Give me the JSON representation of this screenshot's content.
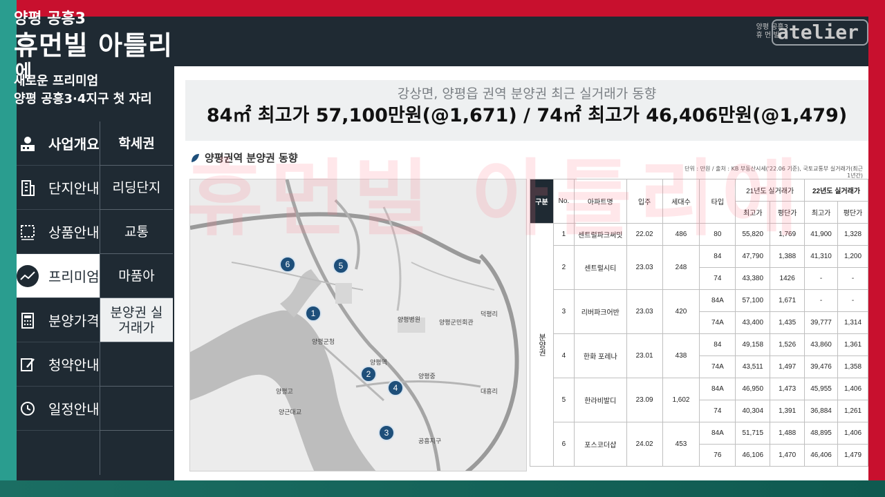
{
  "header": {
    "title_line1": "양평 공흥3",
    "title_line2": "휴먼빌 아틀리",
    "title_overflow": "에",
    "brand_line1": "양평 공흥3",
    "brand_line2": "휴 먼 빌",
    "brand_logo": "atelier"
  },
  "sidebar": {
    "subtitle1": "새로운 프리미엄",
    "subtitle2": "양평 공흥3·4지구 첫 자리",
    "menu": [
      {
        "label": "사업개요",
        "icon": "person-building-icon"
      },
      {
        "label": "단지안내",
        "icon": "building-icon"
      },
      {
        "label": "상품안내",
        "icon": "floorplan-icon"
      },
      {
        "label": "프리미엄",
        "icon": "trend-chart-icon"
      },
      {
        "label": "분양가격",
        "icon": "calculator-icon"
      },
      {
        "label": "청약안내",
        "icon": "document-pen-icon"
      },
      {
        "label": "일정안내",
        "icon": "clock-icon"
      }
    ],
    "submenu": [
      "학세권",
      "리딩단지",
      "교통",
      "마품아",
      "분양권 실거래가"
    ]
  },
  "main": {
    "banner_sub": "강상면, 양평읍 권역 분양권 최근 실거래가 동향",
    "banner_main": "84㎡ 최고가 57,100만원(@1,671) / 74㎡ 최고가 46,406만원(@1,479)",
    "section_title": "양평권역 분양권 동향",
    "unit_note": "단위 : 만원 / 출처 : KB 부동산시세('22.06 기준), 국토교통부 실거래가(최근 1년간)"
  },
  "map": {
    "pins": [
      "1",
      "2",
      "3",
      "4",
      "5",
      "6"
    ],
    "labels": [
      "양평군청",
      "양평역",
      "양평고",
      "양평중",
      "덕평리",
      "양평병원",
      "양평군민회관",
      "공흥지구",
      "대흥리",
      "양근대교"
    ]
  },
  "table": {
    "headers": {
      "category": "구분",
      "no": "No.",
      "name": "아파트명",
      "move_in": "입주",
      "households": "세대수",
      "type": "타입",
      "y21": "21년도 실거래가",
      "y22": "22년도 실거래가",
      "max": "최고가",
      "per_pyeong": "평단가"
    },
    "category_label": "분양권",
    "rows": [
      {
        "no": "1",
        "name": "센트럴파크써밋",
        "move_in": "22.02",
        "households": "486",
        "types": [
          {
            "type": "80",
            "a": "55,820",
            "b": "1,769",
            "c": "41,900",
            "d": "1,328"
          }
        ]
      },
      {
        "no": "2",
        "name": "센트럴시티",
        "move_in": "23.03",
        "households": "248",
        "types": [
          {
            "type": "84",
            "a": "47,790",
            "b": "1,388",
            "c": "41,310",
            "d": "1,200"
          },
          {
            "type": "74",
            "a": "43,380",
            "b": "1426",
            "c": "-",
            "d": "-"
          }
        ]
      },
      {
        "no": "3",
        "name": "리버파크어반",
        "move_in": "23.03",
        "households": "420",
        "types": [
          {
            "type": "84A",
            "a": "57,100",
            "b": "1,671",
            "c": "-",
            "d": "-"
          },
          {
            "type": "74A",
            "a": "43,400",
            "b": "1,435",
            "c": "39,777",
            "d": "1,314"
          }
        ]
      },
      {
        "no": "4",
        "name": "한화 포레나",
        "move_in": "23.01",
        "households": "438",
        "types": [
          {
            "type": "84",
            "a": "49,158",
            "b": "1,526",
            "c": "43,860",
            "d": "1,361"
          },
          {
            "type": "74A",
            "a": "43,511",
            "b": "1,497",
            "c": "39,476",
            "d": "1,358"
          }
        ]
      },
      {
        "no": "5",
        "name": "한라비발디",
        "move_in": "23.09",
        "households": "1,602",
        "types": [
          {
            "type": "84A",
            "a": "46,950",
            "b": "1,473",
            "c": "45,955",
            "d": "1,406"
          },
          {
            "type": "74",
            "a": "40,304",
            "b": "1,391",
            "c": "36,884",
            "d": "1,261"
          }
        ]
      },
      {
        "no": "6",
        "name": "포스코더샵",
        "move_in": "24.02",
        "households": "453",
        "types": [
          {
            "type": "84A",
            "a": "51,715",
            "b": "1,488",
            "c": "48,895",
            "d": "1,406"
          },
          {
            "type": "76",
            "a": "46,106",
            "b": "1,470",
            "c": "46,406",
            "d": "1,479"
          }
        ]
      }
    ]
  },
  "watermark": "휴먼빌 아틀리에",
  "colors": {
    "frame_red": "#c8102e",
    "frame_teal": "#2a9d8f",
    "dark_navy": "#1f2a33",
    "pin_blue": "#1e4f7a"
  }
}
